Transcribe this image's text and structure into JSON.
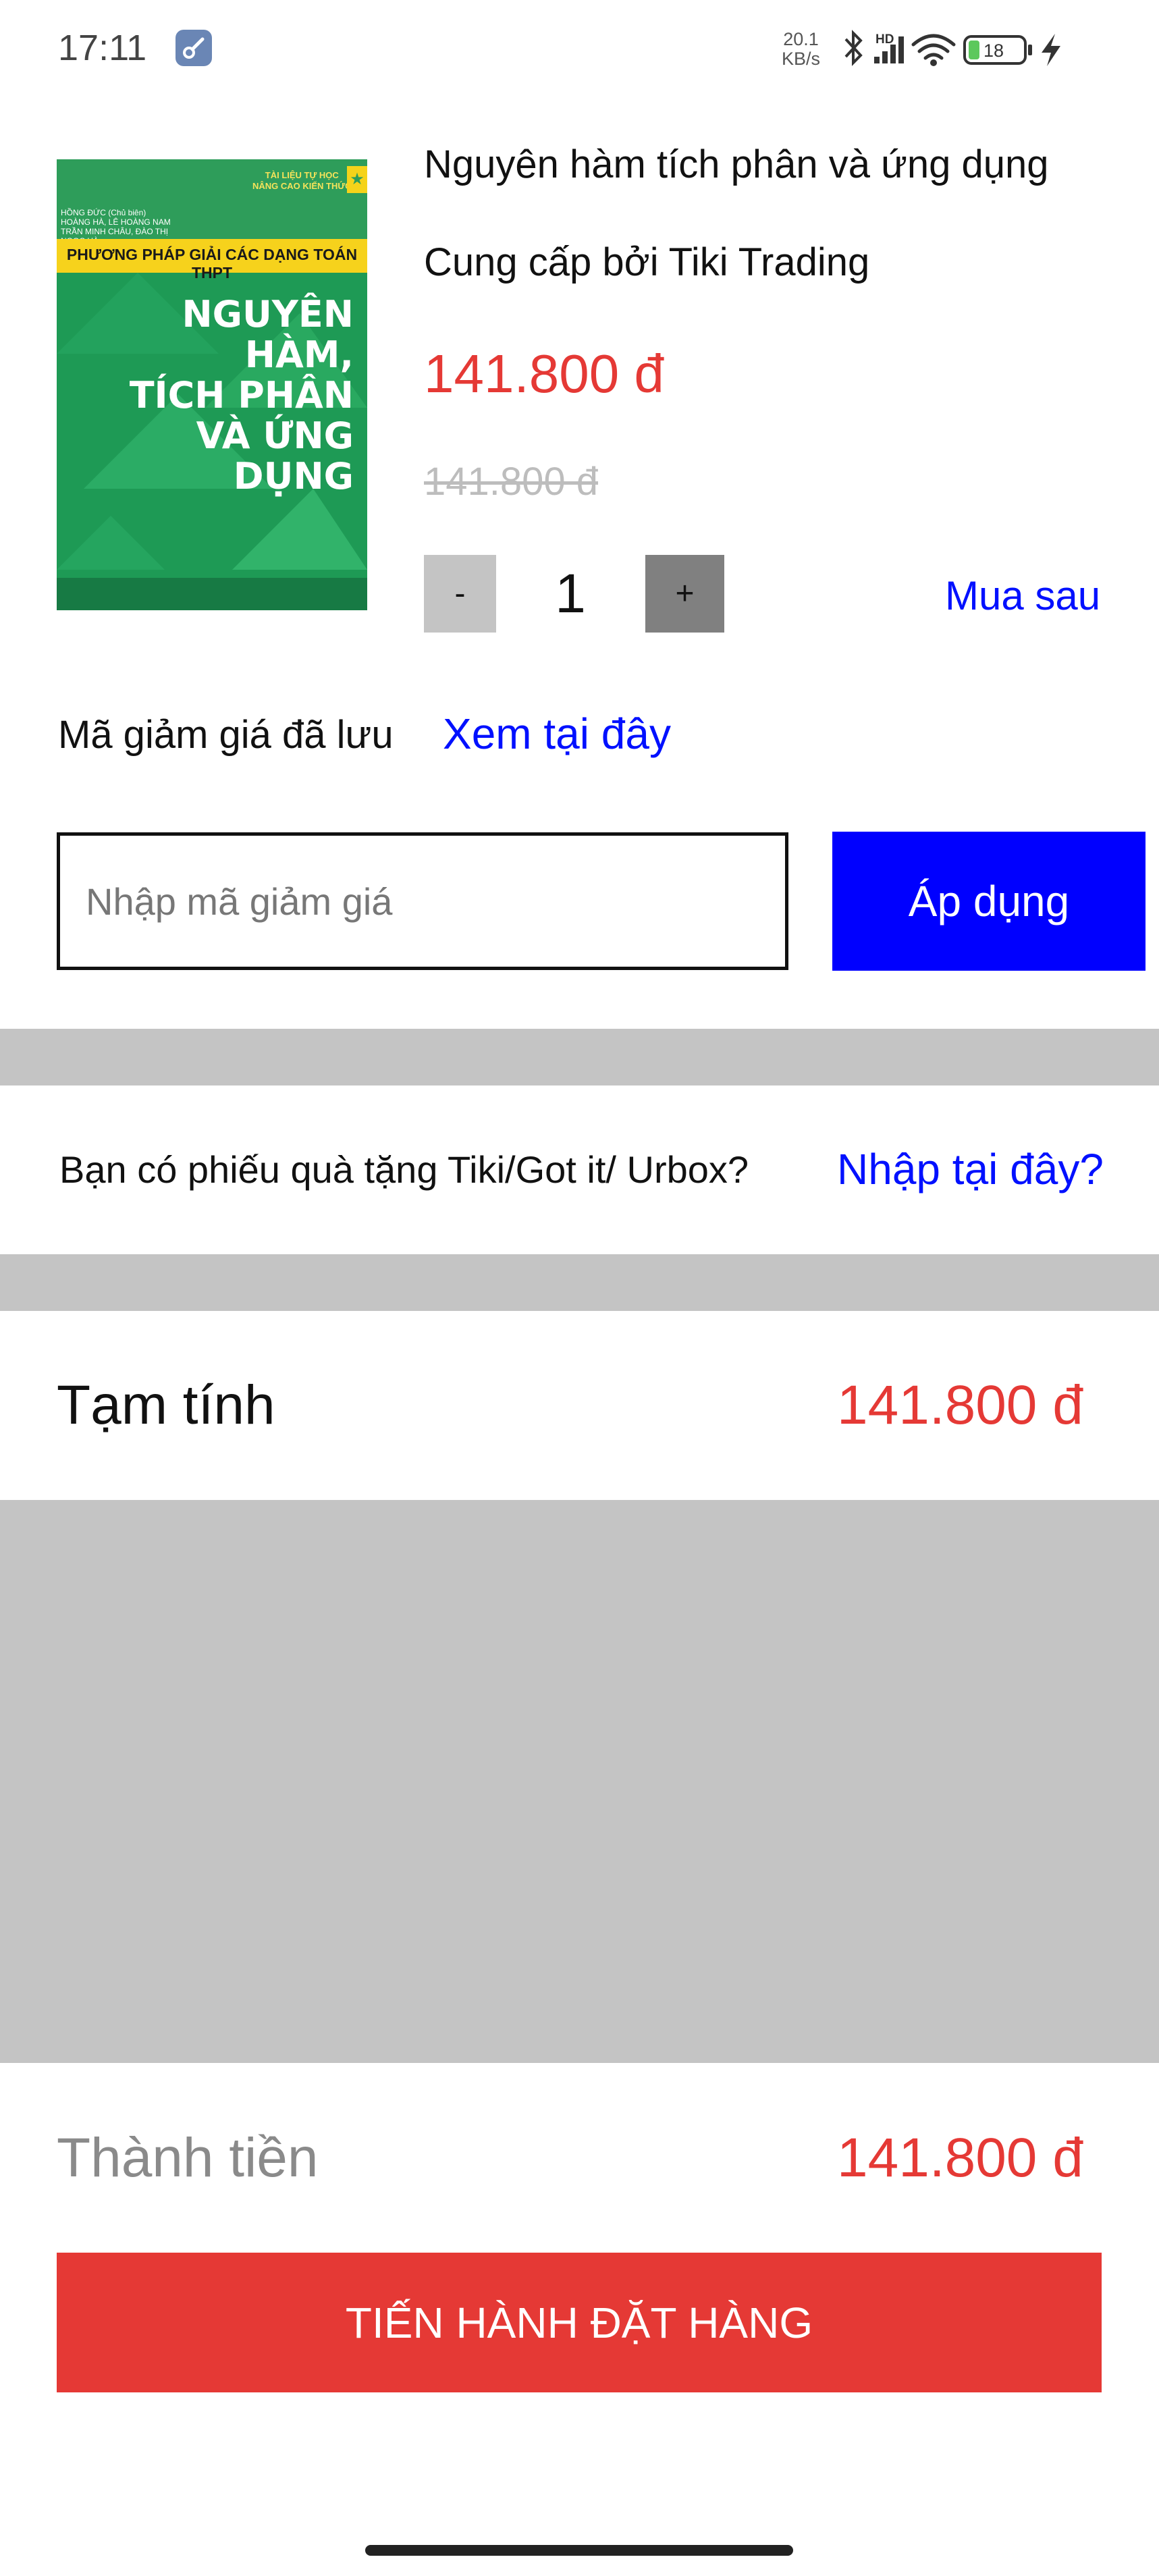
{
  "status_bar": {
    "time": "17:11",
    "net_speed_value": "20.1",
    "net_speed_unit": "KB/s",
    "network_label": "HD",
    "battery": "18",
    "icons": [
      "wrench-icon",
      "bluetooth-icon",
      "signal-icon",
      "wifi-icon",
      "battery-icon",
      "charging-icon"
    ]
  },
  "product": {
    "cover": {
      "authors": [
        "HỒNG ĐỨC (Chủ biên)",
        "HOÀNG HÀ, LÊ HOÀNG NAM",
        "TRẦN MINH CHÂU, ĐÀO THỊ NGỌC HÀ"
      ],
      "series": [
        "TÀI LIỆU TỰ HỌC",
        "NÂNG CAO KIẾN THỨC"
      ],
      "band": "PHƯƠNG PHÁP GIẢI CÁC DẠNG TOÁN THPT",
      "title_lines": [
        "NGUYÊN HÀM,",
        "TÍCH PHÂN",
        "VÀ ỨNG DỤNG"
      ],
      "colors": {
        "green": "#1e9a55",
        "yellow": "#f6d21c"
      }
    },
    "name": "Nguyên hàm tích phân và ứng dụng",
    "seller": "Cung cấp bởi Tiki Trading",
    "price": "141.800 đ",
    "original_price": "141.800 đ",
    "quantity": "1",
    "minus_label": "-",
    "plus_label": "+",
    "buy_later": "Mua sau"
  },
  "coupon": {
    "saved_label": "Mã giảm giá đã lưu",
    "saved_link": "Xem tại đây",
    "input_placeholder": "Nhập mã giảm giá",
    "input_value": "",
    "apply_label": "Áp dụng"
  },
  "gift": {
    "question": "Bạn có phiếu quà tặng Tiki/Got it/ Urbox?",
    "link": "Nhập tại đây?"
  },
  "summary": {
    "subtotal_label": "Tạm tính",
    "subtotal_value": "141.800 đ",
    "total_label": "Thành tiền",
    "total_value": "141.800 đ",
    "checkout_label": "TIẾN HÀNH ĐẶT HÀNG"
  },
  "colors": {
    "price_red": "#e53935",
    "link_blue": "#0010ff",
    "apply_blue": "#0000ff",
    "divider_gray": "#c4c4c4"
  }
}
